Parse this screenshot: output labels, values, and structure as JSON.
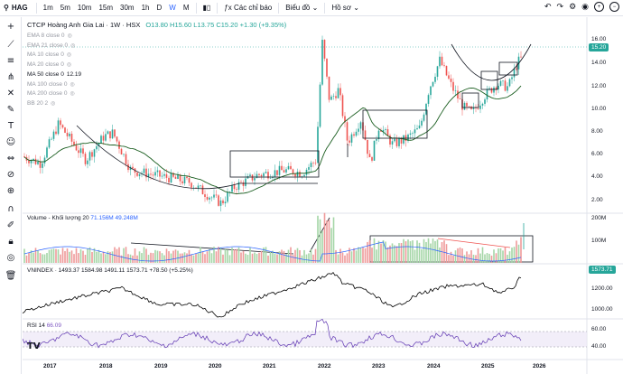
{
  "toolbar": {
    "symbol": "HAG",
    "timeframes": [
      "1m",
      "5m",
      "10m",
      "15m",
      "30m",
      "1h",
      "D",
      "W",
      "M"
    ],
    "active_timeframe": "W",
    "indicators_label": "Các chỉ báo",
    "chart_label": "Biểu đồ",
    "profile_label": "Hồ sơ"
  },
  "main_legend": {
    "title": "CTCP Hoàng Anh Gia Lai · 1W · HSX",
    "ohlc": "O13.80 H15.60 L13.75 C15.20 +1.30 (+9.35%)"
  },
  "indicators": [
    {
      "label": "EMA 8 close 0",
      "active": false
    },
    {
      "label": "EMA 21 close 0",
      "active": false
    },
    {
      "label": "MA 10 close 0",
      "active": false
    },
    {
      "label": "MA 20 close 0",
      "active": false
    },
    {
      "label": "MA 50 close 0",
      "active": true,
      "value": "12.19"
    },
    {
      "label": "MA 100 close 0",
      "active": false
    },
    {
      "label": "MA 200 close 0",
      "active": false
    },
    {
      "label": "BB 20 2",
      "active": false
    }
  ],
  "price_axis": [
    "16.00",
    "14.00",
    "12.00",
    "10.00",
    "8.00",
    "6.00",
    "4.00",
    "2.00"
  ],
  "last_price": "15.20",
  "volume_legend": {
    "label": "Volume - Khối lượng 20",
    "v1": "71.156M",
    "v2": "49.248M"
  },
  "volume_axis": [
    "200M",
    "100M"
  ],
  "vnindex_legend": "VNINDEX · 1493.37 1584.98 1491.11 1573.71 +78.50 (+5.25%)",
  "vnindex_axis": [
    "1200.00",
    "1000.00"
  ],
  "vnindex_last": "1573.71",
  "rsi_legend": {
    "label": "RSI 14",
    "value": "66.09"
  },
  "rsi_axis": [
    "60.00",
    "40.00"
  ],
  "x_axis": [
    "2017",
    "2018",
    "2019",
    "2020",
    "2021",
    "2022",
    "2023",
    "2024",
    "2025",
    "2026"
  ],
  "colors": {
    "up": "#26a69a",
    "down": "#ef5350",
    "ma": "#1b5e20",
    "index": "#000000",
    "rsi": "#7e57c2",
    "accent": "#2962ff"
  }
}
